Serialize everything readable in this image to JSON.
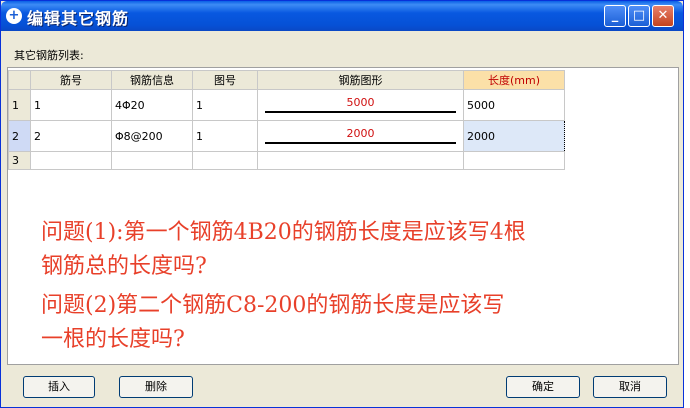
{
  "window": {
    "title": "编辑其它钢筋"
  },
  "list_label": "其它钢筋列表:",
  "table": {
    "headers": [
      "筋号",
      "钢筋信息",
      "图号",
      "钢筋图形",
      "长度(mm)"
    ],
    "rows": [
      {
        "num": "1",
        "bar_no": "1",
        "info": "4Φ20",
        "figure_no": "1",
        "shape_value": "5000",
        "length": "5000"
      },
      {
        "num": "2",
        "bar_no": "2",
        "info": "Φ8@200",
        "figure_no": "1",
        "shape_value": "2000",
        "length": "2000"
      },
      {
        "num": "3",
        "bar_no": "",
        "info": "",
        "figure_no": "",
        "shape_value": "",
        "length": ""
      }
    ]
  },
  "annotation": {
    "line1": "问题(1):第一个钢筋4B20的钢筋长度是应该写4根",
    "line2": "钢筋总的长度吗?",
    "line3": "问题(2)第二个钢筋C8-200的钢筋长度是应该写",
    "line4": "一根的长度吗?"
  },
  "buttons": {
    "insert": "插入",
    "delete": "删除",
    "ok": "确定",
    "cancel": "取消"
  },
  "colors": {
    "title_bar": "#0858e0",
    "annotation": "#e8402a",
    "length_header": "#fbe0a8"
  }
}
